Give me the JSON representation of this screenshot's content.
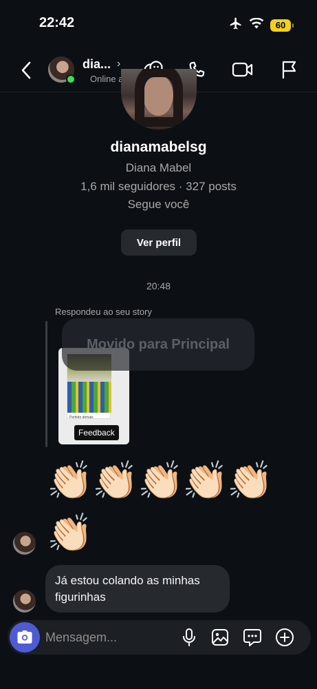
{
  "status_bar": {
    "time": "22:42",
    "battery": "60",
    "icons": [
      "airplane-icon",
      "wifi-icon",
      "battery-icon"
    ]
  },
  "header": {
    "name": "dia...",
    "status": "Online a",
    "icons": [
      "back-icon",
      "avatar-stickers-icon",
      "phone-icon",
      "video-icon",
      "flag-icon"
    ]
  },
  "profile": {
    "username": "dianamabelsg",
    "full_name": "Diana Mabel",
    "stats": "1,6 mil seguidores · 327 posts",
    "follows_you": "Segue você",
    "view_profile_label": "Ver perfil"
  },
  "thread": {
    "timestamp": "20:48",
    "replied_label": "Respondeu ao seu story",
    "toast": "Movido para Principal",
    "story_caption": "Perfeito demais",
    "story_feedback": "Feedback",
    "clap_emoji": "👏🏻",
    "message": "Já estou colando as minhas figurinhas"
  },
  "composer": {
    "placeholder": "Mensagem...",
    "icons": [
      "camera-icon",
      "mic-icon",
      "gallery-icon",
      "sticker-icon",
      "plus-icon"
    ]
  },
  "colors": {
    "accent": "#4f5bd5",
    "online": "#3ddc53",
    "battery": "#f4d11d",
    "background": "#0c1014",
    "bubble": "#262a2f"
  }
}
